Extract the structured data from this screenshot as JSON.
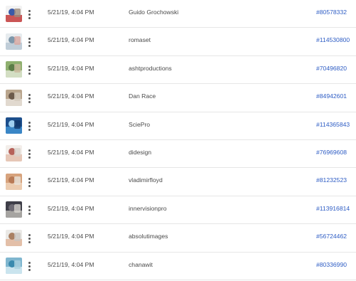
{
  "rows": [
    {
      "date": "5/21/19, 4:04 PM",
      "author": "Guido Grochowski",
      "id": "#80578332",
      "thumb": "sign",
      "colors": [
        "#f2f2f2",
        "#c33a3a",
        "#3a5aa8",
        "#9b8a7a"
      ]
    },
    {
      "date": "5/21/19, 4:04 PM",
      "author": "romaset",
      "id": "#114530800",
      "thumb": "medic",
      "colors": [
        "#e7ecef",
        "#b9c8d4",
        "#7f98ab",
        "#d9a8a0"
      ]
    },
    {
      "date": "5/21/19, 4:04 PM",
      "author": "ashtproductions",
      "id": "#70496820",
      "thumb": "garden",
      "colors": [
        "#8fb06f",
        "#dfe6d2",
        "#5c7d48",
        "#c9b79b"
      ]
    },
    {
      "date": "5/21/19, 4:04 PM",
      "author": "Dan Race",
      "id": "#84942601",
      "thumb": "kitchen",
      "colors": [
        "#b9a58d",
        "#e8e2da",
        "#6c5a4b",
        "#d4cbbd"
      ]
    },
    {
      "date": "5/21/19, 4:04 PM",
      "author": "SciePro",
      "id": "#114365843",
      "thumb": "xray",
      "colors": [
        "#1d4f8c",
        "#3f8fd0",
        "#9fd0f0",
        "#0f3466"
      ]
    },
    {
      "date": "5/21/19, 4:04 PM",
      "author": "didesign",
      "id": "#76969608",
      "thumb": "pain",
      "colors": [
        "#f3eeea",
        "#e3c0ae",
        "#b6625a",
        "#d9d2cc"
      ]
    },
    {
      "date": "5/21/19, 4:04 PM",
      "author": "vladimirfloyd",
      "id": "#81232523",
      "thumb": "massage",
      "colors": [
        "#d7a37d",
        "#f0d3b8",
        "#b87a56",
        "#e9e2da"
      ]
    },
    {
      "date": "5/21/19, 4:04 PM",
      "author": "innervisionpro",
      "id": "#113916814",
      "thumb": "person",
      "colors": [
        "#3e3e48",
        "#b9b6b2",
        "#6d6a73",
        "#d8d4cf"
      ]
    },
    {
      "date": "5/21/19, 4:04 PM",
      "author": "absolutimages",
      "id": "#56724462",
      "thumb": "face",
      "colors": [
        "#eae9e6",
        "#e2b79c",
        "#a98063",
        "#c9c6c2"
      ]
    },
    {
      "date": "5/21/19, 4:04 PM",
      "author": "chanawit",
      "id": "#80336990",
      "thumb": "hospital",
      "colors": [
        "#7fb6cf",
        "#d7ecf3",
        "#3a8aae",
        "#a9d1df"
      ]
    }
  ]
}
